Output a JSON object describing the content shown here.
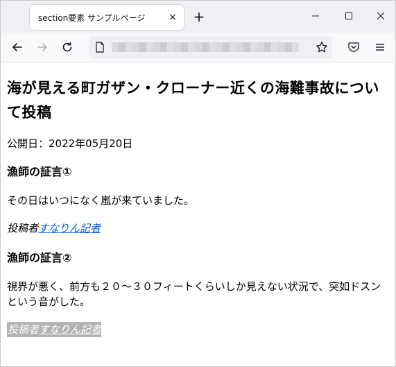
{
  "browser": {
    "tab_title": "section要素 サンプルページ",
    "tab_close": "×",
    "new_tab": "+"
  },
  "article": {
    "title": "海が見える町ガザン・クローナー近くの海難事故について投稿",
    "published": "公開日：2022年05月20日",
    "sections": [
      {
        "heading": "漁師の証言①",
        "body": "その日はいつになく嵐が来ていました。",
        "author_prefix": "投稿者",
        "author_name": "すなりん記者"
      },
      {
        "heading": "漁師の証言②",
        "body": "視界が悪く、前方も２０～３０フィートくらいしか見えない状況で、突如ドスンという音がした。",
        "author_prefix": "投稿者",
        "author_name": "すなりん記者"
      }
    ]
  }
}
